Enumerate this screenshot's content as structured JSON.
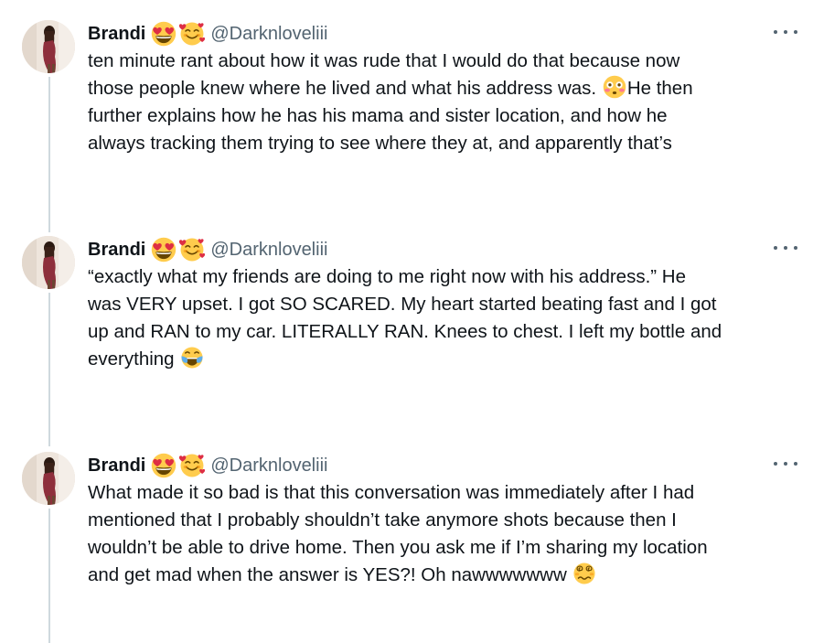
{
  "tweets": [
    {
      "name": "Brandi",
      "handle": "@Darknloveliii",
      "emojis": [
        "heart-eyes",
        "smiling-hearts"
      ],
      "text_parts": [
        "ten minute rant about how it was rude that I would do that because now\nthose people knew where he lived and what his address was. ",
        "He then\nfurther explains how he has his mama and sister location, and how he\nalways tracking them trying to see where they at, and apparently that’s"
      ],
      "inline_emoji": "flushed-face"
    },
    {
      "name": "Brandi",
      "handle": "@Darknloveliii",
      "emojis": [
        "heart-eyes",
        "smiling-hearts"
      ],
      "text_parts": [
        "“exactly what my friends are doing to me right now with his address.” He\nwas VERY upset. I got SO SCARED. My heart started beating fast and I got\nup and RAN to my car. LITERALLY RAN. Knees to chest. I left my bottle and\neverything ",
        ""
      ],
      "inline_emoji": "tears-of-joy"
    },
    {
      "name": "Brandi",
      "handle": "@Darknloveliii",
      "emojis": [
        "heart-eyes",
        "smiling-hearts"
      ],
      "text_parts": [
        "What made it so bad is that this conversation was immediately after I had\nmentioned that I probably shouldn’t take anymore shots because then I\nwouldn’t be able to drive home. Then you ask me if I’m sharing my location\nand get mad when the answer is YES?! Oh nawwwwwww ",
        ""
      ],
      "inline_emoji": "woozy-face"
    }
  ],
  "colors": {
    "text": "#0f1419",
    "secondary": "#536471",
    "thread_line": "#cfd9de",
    "emoji_yellow": "#ffcc4d",
    "heart_red": "#dd2e44"
  }
}
